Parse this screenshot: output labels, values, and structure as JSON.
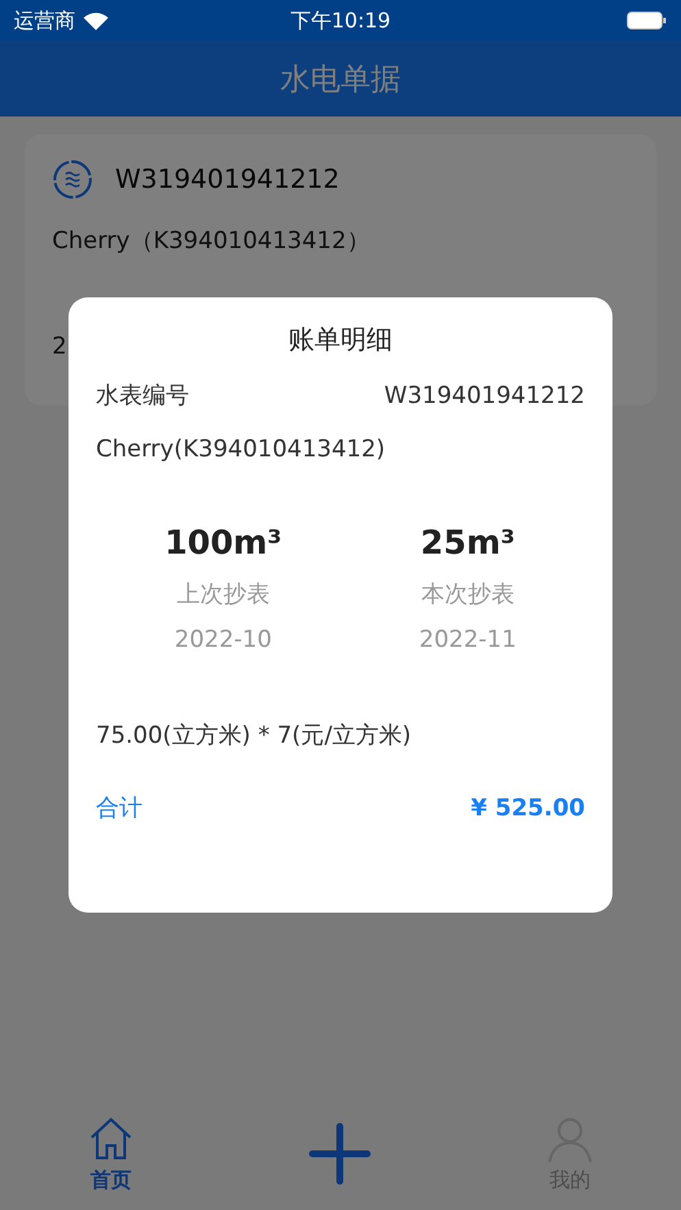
{
  "status_bar": {
    "carrier": "运营商",
    "time": "下午10:19"
  },
  "header": {
    "title": "水电单据"
  },
  "card": {
    "meter_no": "W319401941212",
    "customer": "Cherry（K394010413412）",
    "line_3": "2"
  },
  "dialog": {
    "title": "账单明细",
    "meter_label": "水表编号",
    "meter_no": "W319401941212",
    "customer": "Cherry(K394010413412)",
    "readings": [
      {
        "value": "100m³",
        "label": "上次抄表",
        "date": "2022-10"
      },
      {
        "value": "25m³",
        "label": "本次抄表",
        "date": "2022-11"
      }
    ],
    "formula": "75.00(立方米) * 7(元/立方米)",
    "total_label": "合计",
    "total": "¥ 525.00"
  },
  "tabs": [
    {
      "kind": "home",
      "label": "首页",
      "selected": true
    },
    {
      "kind": "add"
    },
    {
      "kind": "profile",
      "label": "我的",
      "selected": false
    }
  ]
}
